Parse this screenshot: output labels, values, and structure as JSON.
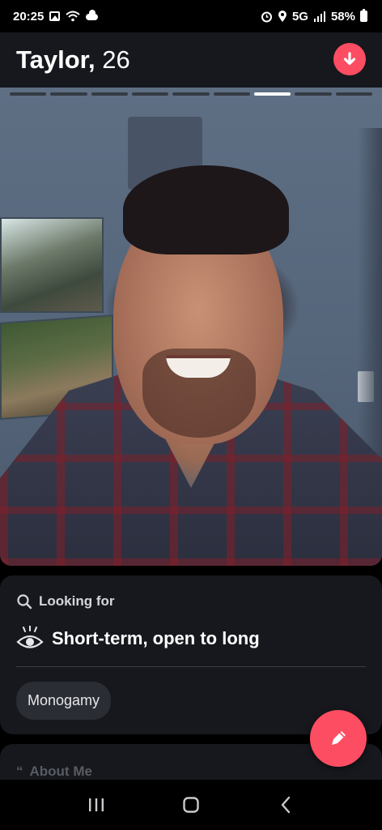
{
  "status_bar": {
    "time": "20:25",
    "network": "5G",
    "battery": "58%"
  },
  "profile": {
    "name": "Taylor,",
    "age": "26"
  },
  "photos": {
    "count": 9,
    "active_index": 6
  },
  "looking_for": {
    "label": "Looking for",
    "value": "Short-term, open to long",
    "chip": "Monogamy"
  },
  "about": {
    "title": "About Me"
  },
  "colors": {
    "accent": "#fd4d62",
    "card_bg": "#16181d"
  },
  "icons": {
    "down": "arrow-down-icon",
    "search": "search-icon",
    "eye": "eye-icon",
    "quote": "quote-icon",
    "edit": "pencil-icon",
    "recents": "recents-icon",
    "home": "home-icon",
    "back": "back-icon"
  }
}
